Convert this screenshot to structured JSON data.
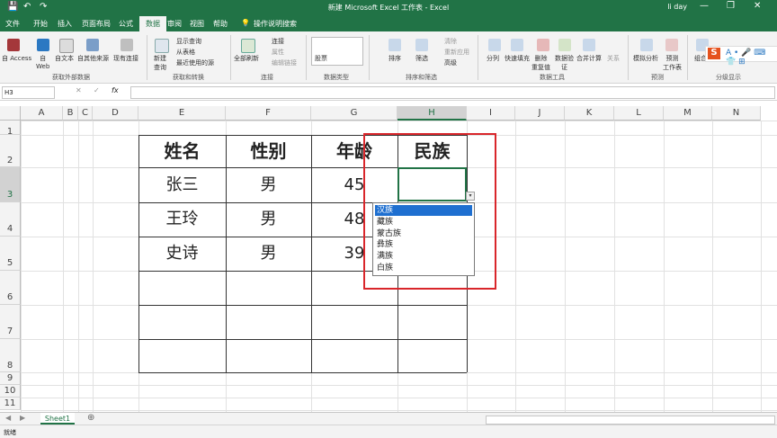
{
  "window": {
    "title": "新建 Microsoft Excel 工作表 - Excel",
    "user": "li day",
    "min": "—",
    "restore": "❐",
    "close": "✕"
  },
  "quick_access": {
    "save": "💾",
    "undo": "↶",
    "redo": "↷"
  },
  "tabs": [
    "文件",
    "开始",
    "插入",
    "页面布局",
    "公式",
    "数据",
    "审阅",
    "视图",
    "帮助"
  ],
  "active_tab": "数据",
  "tell_me": "操作说明搜索",
  "ribbon": {
    "get_external": {
      "label": "获取外部数据",
      "items": [
        "自 Access",
        "自\nWeb",
        "自文本",
        "自其他来源",
        "现有连接"
      ]
    },
    "get_transform": {
      "label": "获取和转换",
      "new_query": "新建\n查询",
      "show_query": "显示查询",
      "from_table": "从表格",
      "recent_sources": "最近使用的源"
    },
    "connections": {
      "label": "连接",
      "refresh_all": "全部刷新",
      "connections": "连接",
      "properties": "属性",
      "edit_links": "编辑链接"
    },
    "data_types": {
      "label": "数据类型",
      "stocks": "股票"
    },
    "sort_filter": {
      "label": "排序和筛选",
      "sort": "排序",
      "filter": "筛选",
      "clear": "清除",
      "reapply": "重新应用",
      "advanced": "高级"
    },
    "data_tools": {
      "label": "数据工具",
      "split": "分列",
      "flash_fill": "快速填充",
      "remove_dup": "删除\n重复值",
      "validation": "数据验\n证",
      "consolidate": "合并计算",
      "relations": "关系"
    },
    "forecast": {
      "label": "预测",
      "what_if": "模拟分析",
      "forecast_sheet": "预测\n工作表"
    },
    "outline": {
      "label": "分级显示",
      "group": "组合"
    }
  },
  "formula_bar": {
    "name_box": "H3",
    "cancel": "✕",
    "enter": "✓",
    "fx": "fx",
    "value": ""
  },
  "columns": [
    "A",
    "B",
    "C",
    "D",
    "E",
    "F",
    "G",
    "H",
    "I",
    "J",
    "K",
    "L",
    "M",
    "N"
  ],
  "rows": [
    "1",
    "2",
    "3",
    "4",
    "5",
    "6",
    "7",
    "8",
    "9",
    "10",
    "11"
  ],
  "table": {
    "headers": [
      "姓名",
      "性别",
      "年龄",
      "民族"
    ],
    "rows": [
      [
        "张三",
        "男",
        "45",
        ""
      ],
      [
        "王玲",
        "男",
        "48",
        ""
      ],
      [
        "史诗",
        "男",
        "39",
        ""
      ]
    ]
  },
  "dropdown": {
    "arrow": "▾",
    "options": [
      "汉族",
      "藏族",
      "蒙古族",
      "彝族",
      "满族",
      "白族"
    ],
    "selected": "汉族"
  },
  "sheets": {
    "names": [
      "Sheet1"
    ],
    "add": "⊕"
  },
  "status": {
    "ready": "就绪"
  },
  "ime": {
    "logo": "S"
  },
  "colors": {
    "excel_green": "#217346",
    "highlight_red": "#d9262b",
    "selection_blue": "#1e6fd0"
  }
}
